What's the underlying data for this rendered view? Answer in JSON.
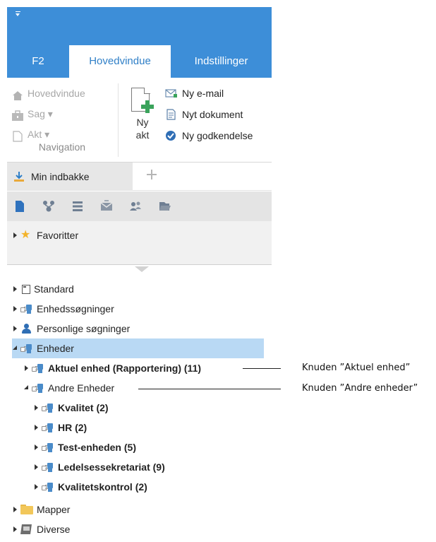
{
  "ribbon": {
    "tabs": [
      {
        "label": "F2"
      },
      {
        "label": "Hovedvindue"
      },
      {
        "label": "Indstillinger"
      }
    ],
    "navigation": {
      "items": [
        {
          "label": "Hovedvindue",
          "icon": "home-icon"
        },
        {
          "label": "Sag ▾",
          "icon": "case-icon"
        },
        {
          "label": "Akt ▾",
          "icon": "document-icon"
        }
      ],
      "group_label": "Navigation"
    },
    "new_akt": {
      "label_line1": "Ny",
      "label_line2": "akt"
    },
    "commands": [
      {
        "label": "Ny e-mail",
        "icon": "new-email-icon"
      },
      {
        "label": "Nyt dokument",
        "icon": "new-document-icon"
      },
      {
        "label": "Ny godkendelse",
        "icon": "new-approval-icon"
      }
    ]
  },
  "inbox": {
    "tab_label": "Min indbakke"
  },
  "toolbar": {
    "icons": [
      "document-icon",
      "org-chart-icon",
      "list-icon",
      "mail-icon",
      "people-icon",
      "folder-open-icon"
    ]
  },
  "favorites": {
    "label": "Favoritter"
  },
  "tree": {
    "standard": "Standard",
    "unit_searches": "Enhedssøgninger",
    "personal_searches": "Personlige søgninger",
    "units": "Enheder",
    "current_unit": "Aktuel enhed (Rapportering) (11)",
    "other_units": "Andre Enheder",
    "children": [
      "Kvalitet (2)",
      "HR (2)",
      "Test-enheden (5)",
      "Ledelsessekretariat (9)",
      "Kvalitetskontrol (2)"
    ],
    "folders": "Mapper",
    "misc": "Diverse"
  },
  "annotations": {
    "current_unit_node": "Knuden ”Aktuel enhed”",
    "other_units_node": "Knuden ”Andre enheder”"
  },
  "colors": {
    "ribbon_blue": "#3d8ed8",
    "selected_row": "#b9d9f4",
    "active_tab_text": "#2f7fc7"
  }
}
